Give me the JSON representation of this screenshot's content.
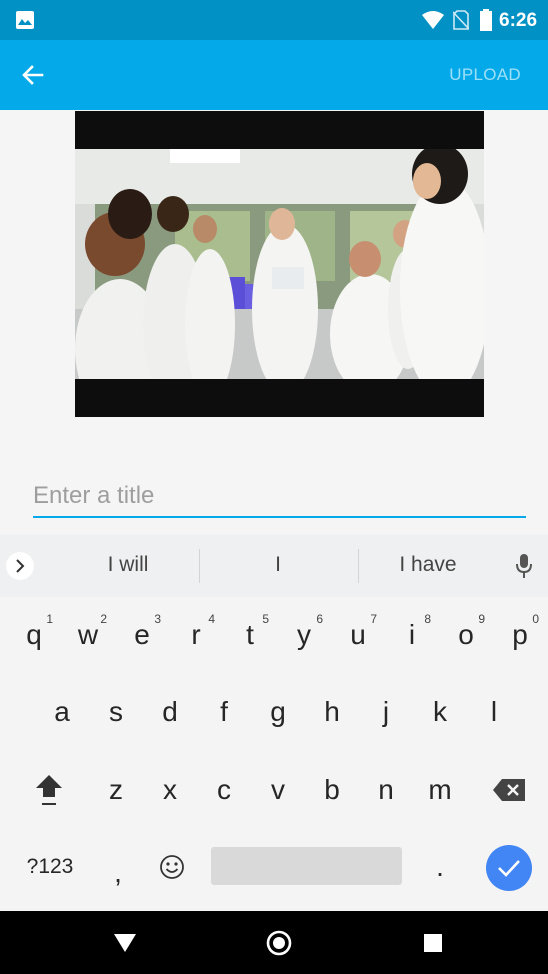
{
  "status_bar": {
    "time": "6:26",
    "icons": [
      "gallery-icon",
      "wifi-icon",
      "no-sim-icon",
      "battery-icon"
    ]
  },
  "app_bar": {
    "back_icon": "arrow-back-icon",
    "upload_label": "UPLOAD"
  },
  "video": {
    "description_icon": "video-thumbnail"
  },
  "title_field": {
    "placeholder": "Enter a title",
    "value": ""
  },
  "suggestions": {
    "items": [
      "I will",
      "I",
      "I have"
    ]
  },
  "keyboard": {
    "row1": [
      {
        "key": "q",
        "hint": "1"
      },
      {
        "key": "w",
        "hint": "2"
      },
      {
        "key": "e",
        "hint": "3"
      },
      {
        "key": "r",
        "hint": "4"
      },
      {
        "key": "t",
        "hint": "5"
      },
      {
        "key": "y",
        "hint": "6"
      },
      {
        "key": "u",
        "hint": "7"
      },
      {
        "key": "i",
        "hint": "8"
      },
      {
        "key": "o",
        "hint": "9"
      },
      {
        "key": "p",
        "hint": "0"
      }
    ],
    "row2": [
      "a",
      "s",
      "d",
      "f",
      "g",
      "h",
      "j",
      "k",
      "l"
    ],
    "row3": [
      "z",
      "x",
      "c",
      "v",
      "b",
      "n",
      "m"
    ],
    "symbols_label": "?123",
    "comma": ",",
    "period": "."
  },
  "colors": {
    "status_bar": "#0291c5",
    "app_bar": "#03a9e8",
    "accent": "#03a9e8",
    "enter_key": "#4285f4"
  }
}
